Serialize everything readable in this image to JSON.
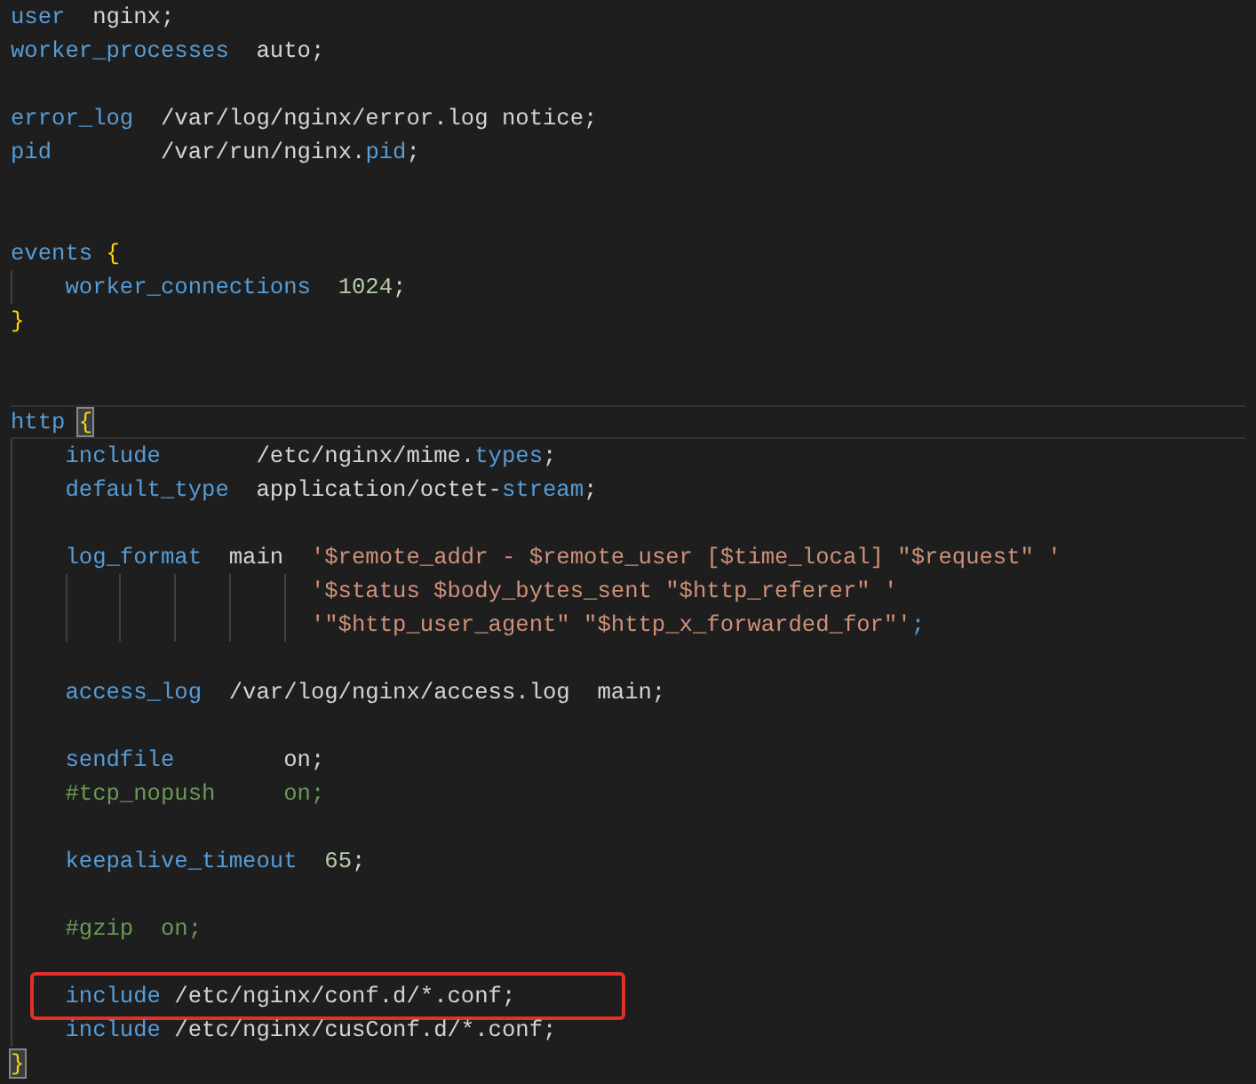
{
  "editor": {
    "lines": [
      {
        "kind": "code",
        "current": false,
        "highlighted": false,
        "tokens": [
          {
            "text": "user",
            "kind": "kw"
          },
          {
            "text": "  nginx;",
            "kind": "plain"
          }
        ]
      },
      {
        "kind": "code",
        "current": false,
        "highlighted": false,
        "tokens": [
          {
            "text": "worker_processes",
            "kind": "kw"
          },
          {
            "text": "  auto;",
            "kind": "plain"
          }
        ]
      },
      {
        "kind": "blank"
      },
      {
        "kind": "code",
        "current": false,
        "highlighted": false,
        "tokens": [
          {
            "text": "error_log",
            "kind": "kw"
          },
          {
            "text": "  /var/log/nginx/error.log notice;",
            "kind": "plain"
          }
        ]
      },
      {
        "kind": "code",
        "current": false,
        "highlighted": false,
        "tokens": [
          {
            "text": "pid",
            "kind": "kw"
          },
          {
            "text": "        /var/run/nginx.",
            "kind": "plain"
          },
          {
            "text": "pid",
            "kind": "kw"
          },
          {
            "text": ";",
            "kind": "plain"
          }
        ]
      },
      {
        "kind": "blank"
      },
      {
        "kind": "blank"
      },
      {
        "kind": "code",
        "current": false,
        "highlighted": false,
        "tokens": [
          {
            "text": "events ",
            "kind": "kw"
          },
          {
            "text": "{",
            "kind": "brace",
            "matched": false
          }
        ]
      },
      {
        "kind": "code",
        "current": false,
        "highlighted": false,
        "tokens": [
          {
            "text": "    worker_connections  ",
            "kind": "kw"
          },
          {
            "text": "1024",
            "kind": "num"
          },
          {
            "text": ";",
            "kind": "plain"
          }
        ]
      },
      {
        "kind": "code",
        "current": false,
        "highlighted": false,
        "tokens": [
          {
            "text": "}",
            "kind": "brace",
            "matched": false
          }
        ]
      },
      {
        "kind": "blank"
      },
      {
        "kind": "blank"
      },
      {
        "kind": "code",
        "current": true,
        "highlighted": false,
        "tokens": [
          {
            "text": "http ",
            "kind": "kw"
          },
          {
            "text": "{",
            "kind": "brace",
            "matched": true
          }
        ]
      },
      {
        "kind": "code",
        "current": false,
        "highlighted": false,
        "tokens": [
          {
            "text": "    include",
            "kind": "kw"
          },
          {
            "text": "       /etc/nginx/mime.",
            "kind": "plain"
          },
          {
            "text": "types",
            "kind": "kw"
          },
          {
            "text": ";",
            "kind": "plain"
          }
        ]
      },
      {
        "kind": "code",
        "current": false,
        "highlighted": false,
        "tokens": [
          {
            "text": "    default_type",
            "kind": "kw"
          },
          {
            "text": "  application/octet-",
            "kind": "plain"
          },
          {
            "text": "stream",
            "kind": "kw"
          },
          {
            "text": ";",
            "kind": "plain"
          }
        ]
      },
      {
        "kind": "blank"
      },
      {
        "kind": "code",
        "current": false,
        "highlighted": false,
        "tokens": [
          {
            "text": "    log_format",
            "kind": "kw"
          },
          {
            "text": "  main  ",
            "kind": "plain"
          },
          {
            "text": "'$remote_addr - $remote_user [$time_local] \"$request\" '",
            "kind": "str"
          }
        ]
      },
      {
        "kind": "code",
        "current": false,
        "highlighted": false,
        "tokens": [
          {
            "text": "                      '$status $body_bytes_sent \"$http_referer\" '",
            "kind": "str"
          }
        ]
      },
      {
        "kind": "code",
        "current": false,
        "highlighted": false,
        "tokens": [
          {
            "text": "                      '\"$http_user_agent\" \"$http_x_forwarded_for\"'",
            "kind": "str"
          },
          {
            "text": ";",
            "kind": "kw"
          }
        ]
      },
      {
        "kind": "blank"
      },
      {
        "kind": "code",
        "current": false,
        "highlighted": false,
        "tokens": [
          {
            "text": "    access_log",
            "kind": "kw"
          },
          {
            "text": "  /var/log/nginx/access.log  main;",
            "kind": "plain"
          }
        ]
      },
      {
        "kind": "blank"
      },
      {
        "kind": "code",
        "current": false,
        "highlighted": false,
        "tokens": [
          {
            "text": "    sendfile",
            "kind": "kw"
          },
          {
            "text": "        on;",
            "kind": "plain"
          }
        ]
      },
      {
        "kind": "code",
        "current": false,
        "highlighted": false,
        "tokens": [
          {
            "text": "    #tcp_nopush     on;",
            "kind": "com"
          }
        ]
      },
      {
        "kind": "blank"
      },
      {
        "kind": "code",
        "current": false,
        "highlighted": false,
        "tokens": [
          {
            "text": "    keepalive_timeout  ",
            "kind": "kw"
          },
          {
            "text": "65",
            "kind": "num"
          },
          {
            "text": ";",
            "kind": "plain"
          }
        ]
      },
      {
        "kind": "blank"
      },
      {
        "kind": "code",
        "current": false,
        "highlighted": false,
        "tokens": [
          {
            "text": "    #gzip  on;",
            "kind": "com"
          }
        ]
      },
      {
        "kind": "blank"
      },
      {
        "kind": "code",
        "current": false,
        "highlighted": true,
        "tokens": [
          {
            "text": "    include",
            "kind": "kw"
          },
          {
            "text": " /etc/nginx/conf.d/*.conf;",
            "kind": "plain"
          }
        ]
      },
      {
        "kind": "code",
        "current": false,
        "highlighted": false,
        "tokens": [
          {
            "text": "    include",
            "kind": "kw"
          },
          {
            "text": " /etc/nginx/cusConf.d/*.conf;",
            "kind": "plain"
          }
        ]
      },
      {
        "kind": "code",
        "current": false,
        "highlighted": false,
        "tokens": [
          {
            "text": "}",
            "kind": "brace",
            "matched": true
          }
        ]
      }
    ]
  }
}
